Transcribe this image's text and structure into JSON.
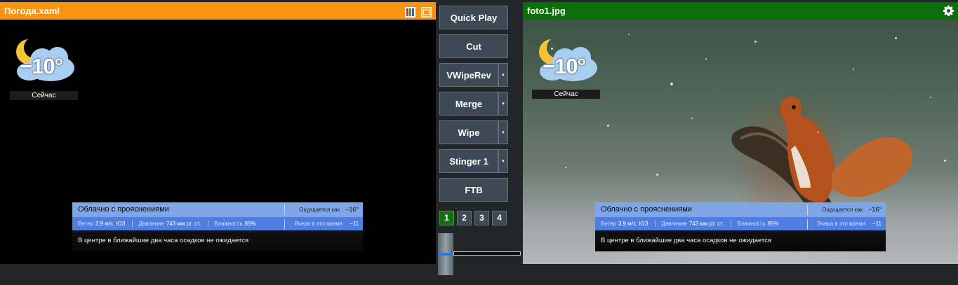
{
  "left_panel": {
    "title": "Погода.xaml",
    "weather": {
      "temperature": "−10°",
      "now_label": "Сейчас",
      "condition": "Облачно с прояснениями",
      "feels_label": "Ощущается как",
      "feels_value": "−16°",
      "wind_label": "Ветер",
      "wind_value": "3,9 м/с, ЮЗ",
      "pressure_label": "Давление",
      "pressure_value": "743 мм рт. ст.",
      "humidity_label": "Влажность",
      "humidity_value": "85%",
      "yesterday_label": "Вчера в это время",
      "yesterday_value": "−11",
      "forecast_note": "В центре в ближайшие два часа осадков не ожидается"
    }
  },
  "right_panel": {
    "title": "foto1.jpg",
    "weather": {
      "temperature": "−10°",
      "now_label": "Сейчас",
      "condition": "Облачно с прояснениями",
      "feels_label": "Ощущается как",
      "feels_value": "−16°",
      "wind_label": "Ветер",
      "wind_value": "3,9 м/с, ЮЗ",
      "pressure_label": "Давление",
      "pressure_value": "743 мм рт. ст.",
      "humidity_label": "Влажность",
      "humidity_value": "85%",
      "yesterday_label": "Вчера в это время",
      "yesterday_value": "−11",
      "forecast_note": "В центре в ближайшие два часа осадков не ожидается"
    }
  },
  "controls": {
    "quick_play": "Quick Play",
    "cut": "Cut",
    "transitions": [
      "VWipeRev",
      "Merge",
      "Wipe",
      "Stinger 1"
    ],
    "dropdown_glyph": "▾",
    "ftb": "FTB",
    "pages": [
      "1",
      "2",
      "3",
      "4"
    ],
    "active_page": "1",
    "tbar_position": 0.5
  },
  "colors": {
    "left_title_bg": "#f7930e",
    "right_title_bg": "#0a6e0a",
    "active_page": "#1a6d16",
    "button_bg": "#3d4955"
  },
  "icons": [
    "multiview-icon",
    "window-icon",
    "gear-icon",
    "moon-cloud-icon"
  ]
}
